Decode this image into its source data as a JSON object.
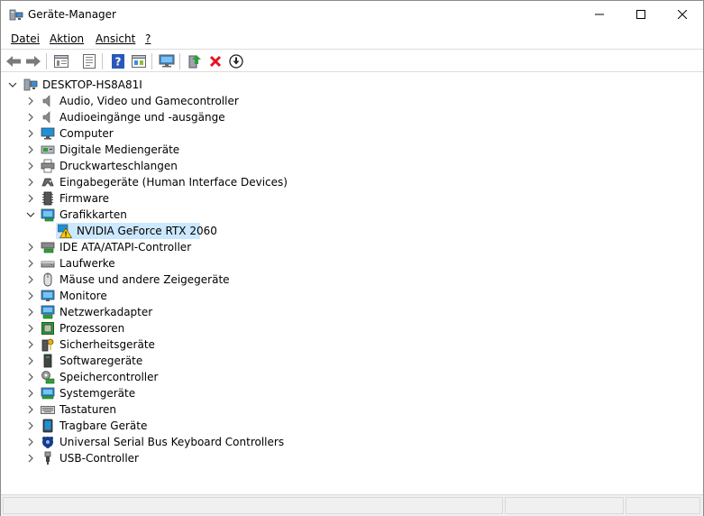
{
  "window": {
    "title": "Geräte-Manager",
    "controls": [
      "minimize",
      "maximize",
      "close"
    ]
  },
  "menu": {
    "items": [
      {
        "label": "Datei"
      },
      {
        "label": "Aktion"
      },
      {
        "label": "Ansicht"
      },
      {
        "label": "?"
      }
    ]
  },
  "toolbar": {
    "buttons": [
      "back-icon",
      "forward-icon",
      "properties-view-icon",
      "properties-icon",
      "help-icon",
      "view-icon",
      "scan-hardware-icon",
      "update-driver-icon",
      "uninstall-icon",
      "download-icon"
    ]
  },
  "tree": {
    "root": "DESKTOP-HS8A81I",
    "categories": [
      {
        "label": "Audio, Video und Gamecontroller",
        "icon": "speaker-icon",
        "expanded": false
      },
      {
        "label": "Audioeingänge und -ausgänge",
        "icon": "speaker-icon",
        "expanded": false
      },
      {
        "label": "Computer",
        "icon": "computer-icon",
        "expanded": false
      },
      {
        "label": "Digitale Mediengeräte",
        "icon": "media-device-icon",
        "expanded": false
      },
      {
        "label": "Druckwarteschlangen",
        "icon": "printer-icon",
        "expanded": false
      },
      {
        "label": "Eingabegeräte (Human Interface Devices)",
        "icon": "hid-icon",
        "expanded": false
      },
      {
        "label": "Firmware",
        "icon": "firmware-icon",
        "expanded": false
      },
      {
        "label": "Grafikkarten",
        "icon": "display-adapter-icon",
        "expanded": true,
        "children": [
          {
            "label": "NVIDIA GeForce RTX 2060",
            "icon": "warning-icon",
            "selected": true
          }
        ]
      },
      {
        "label": "IDE ATA/ATAPI-Controller",
        "icon": "ide-controller-icon",
        "expanded": false
      },
      {
        "label": "Laufwerke",
        "icon": "disk-drive-icon",
        "expanded": false
      },
      {
        "label": "Mäuse und andere Zeigegeräte",
        "icon": "mouse-icon",
        "expanded": false
      },
      {
        "label": "Monitore",
        "icon": "monitor-icon",
        "expanded": false
      },
      {
        "label": "Netzwerkadapter",
        "icon": "network-adapter-icon",
        "expanded": false
      },
      {
        "label": "Prozessoren",
        "icon": "processor-icon",
        "expanded": false
      },
      {
        "label": "Sicherheitsgeräte",
        "icon": "security-device-icon",
        "expanded": false
      },
      {
        "label": "Softwaregeräte",
        "icon": "software-device-icon",
        "expanded": false
      },
      {
        "label": "Speichercontroller",
        "icon": "storage-controller-icon",
        "expanded": false
      },
      {
        "label": "Systemgeräte",
        "icon": "system-device-icon",
        "expanded": false
      },
      {
        "label": "Tastaturen",
        "icon": "keyboard-icon",
        "expanded": false
      },
      {
        "label": "Tragbare Geräte",
        "icon": "portable-device-icon",
        "expanded": false
      },
      {
        "label": "Universal Serial Bus Keyboard Controllers",
        "icon": "usb-keyboard-controller-icon",
        "expanded": false
      },
      {
        "label": "USB-Controller",
        "icon": "usb-icon",
        "expanded": false
      }
    ]
  },
  "colors": {
    "selection": "#cce8ff",
    "uninstall_red": "#e81123",
    "help_blue": "#2a58b8",
    "monitor_blue": "#1e90d8",
    "warning_yellow": "#ffcc00"
  }
}
